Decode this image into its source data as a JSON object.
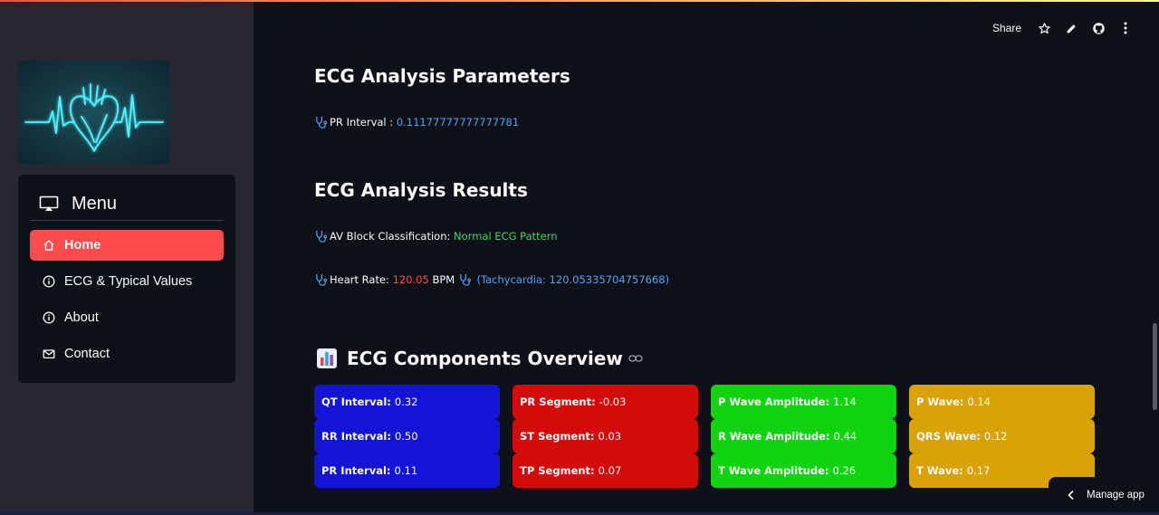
{
  "toolbar": {
    "share_label": "Share"
  },
  "sidebar": {
    "menu_title": "Menu",
    "items": [
      {
        "label": "Home",
        "icon": "house-icon",
        "active": true
      },
      {
        "label": "ECG & Typical Values",
        "icon": "info-icon",
        "active": false
      },
      {
        "label": "About",
        "icon": "info-icon",
        "active": false
      },
      {
        "label": "Contact",
        "icon": "envelope-icon",
        "active": false
      }
    ]
  },
  "params": {
    "title": "ECG Analysis Parameters",
    "pr_label": "PR Interval :",
    "pr_value": "0.11177777777777781"
  },
  "results": {
    "title": "ECG Analysis Results",
    "av_label": "AV Block Classification:",
    "av_value": "Normal ECG Pattern",
    "hr_label": "Heart Rate:",
    "hr_value": "120.05",
    "hr_unit": "BPM",
    "hr_note": "(Tachycardia: 120.05335704757668)"
  },
  "overview": {
    "title": "ECG Components Overview",
    "cells": [
      {
        "label": "QT Interval:",
        "value": "0.32",
        "color": "#1414d6"
      },
      {
        "label": "PR Segment:",
        "value": "-0.03",
        "color": "#d50b0b"
      },
      {
        "label": "P Wave Amplitude:",
        "value": "1.14",
        "color": "#10d410"
      },
      {
        "label": "P Wave:",
        "value": "0.14",
        "color": "#d9a206"
      },
      {
        "label": "RR Interval:",
        "value": "0.50",
        "color": "#1414d6"
      },
      {
        "label": "ST Segment:",
        "value": "0.03",
        "color": "#d50b0b"
      },
      {
        "label": "R Wave Amplitude:",
        "value": "0.44",
        "color": "#10d410"
      },
      {
        "label": "QRS Wave:",
        "value": "0.12",
        "color": "#d9a206"
      },
      {
        "label": "PR Interval:",
        "value": "0.11",
        "color": "#1414d6"
      },
      {
        "label": "TP Segment:",
        "value": "0.07",
        "color": "#d50b0b"
      },
      {
        "label": "T Wave Amplitude:",
        "value": "0.26",
        "color": "#10d410"
      },
      {
        "label": "T Wave:",
        "value": "0.17",
        "color": "#d9a206"
      }
    ]
  },
  "manage": {
    "label": "Manage app"
  },
  "colors": {
    "accent": "#ff4b4b",
    "background": "#0e1117",
    "sidebar": "#262730"
  }
}
